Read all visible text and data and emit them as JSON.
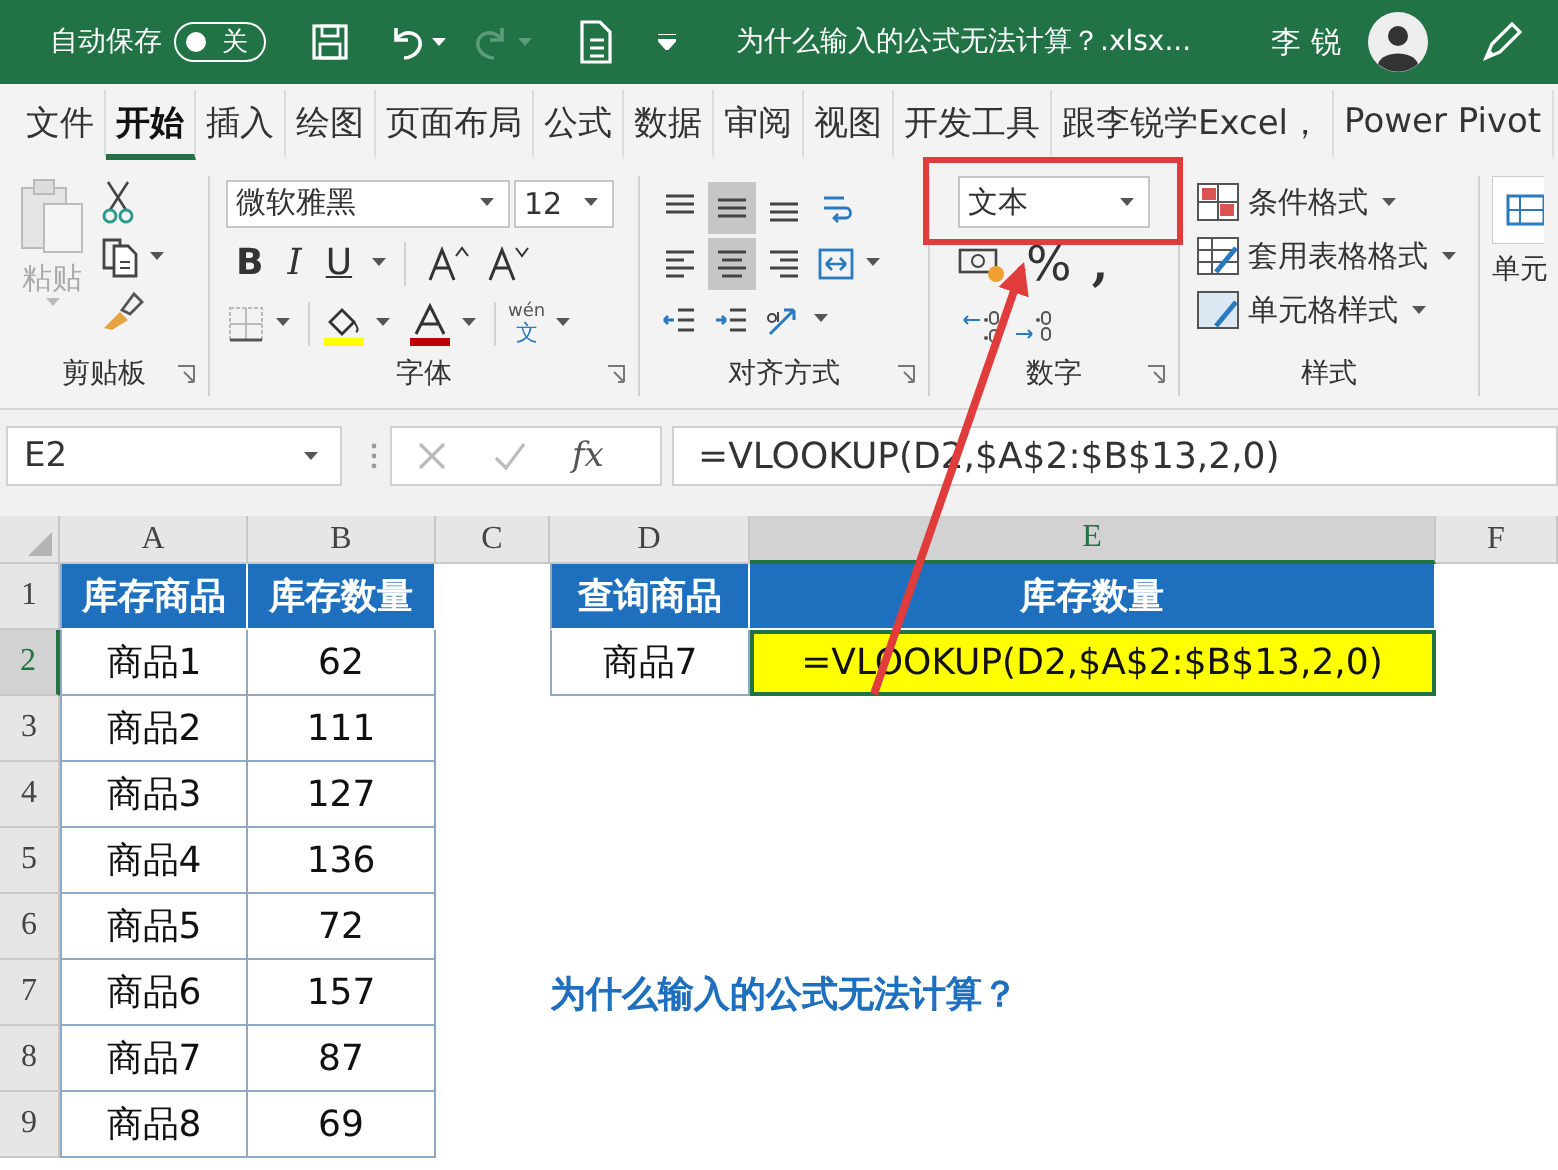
{
  "title_bar": {
    "autosave_label": "自动保存",
    "autosave": {
      "label": "关",
      "on": false
    },
    "file_name": "为什么输入的公式无法计算？.xlsx...",
    "user_name": "李 锐"
  },
  "menu_tabs": [
    {
      "label": "文件",
      "selected": false
    },
    {
      "label": "开始",
      "selected": true
    },
    {
      "label": "插入",
      "selected": false
    },
    {
      "label": "绘图",
      "selected": false
    },
    {
      "label": "页面布局",
      "selected": false
    },
    {
      "label": "公式",
      "selected": false
    },
    {
      "label": "数据",
      "selected": false
    },
    {
      "label": "审阅",
      "selected": false
    },
    {
      "label": "视图",
      "selected": false
    },
    {
      "label": "开发工具",
      "selected": false
    },
    {
      "label": "跟李锐学Excel，",
      "selected": false
    },
    {
      "label": "Power Pivot",
      "selected": false
    }
  ],
  "ribbon": {
    "clipboard": {
      "paste_label": "粘贴",
      "group_label": "剪贴板"
    },
    "font": {
      "font_name": "微软雅黑",
      "font_size": "12",
      "style_buttons": [
        "B",
        "I",
        "U"
      ],
      "phonetic_top": "wén",
      "phonetic_bottom": "文",
      "group_label": "字体"
    },
    "alignment": {
      "buttons": [
        {
          "kind": "top",
          "selected": false
        },
        {
          "kind": "middle",
          "selected": true
        },
        {
          "kind": "bottom",
          "selected": false
        },
        {
          "kind": "wrap",
          "selected": false
        },
        {
          "kind": "left",
          "selected": false
        },
        {
          "kind": "center",
          "selected": true
        },
        {
          "kind": "right",
          "selected": false
        },
        {
          "kind": "merge",
          "selected": false
        },
        {
          "kind": "outdent",
          "selected": false
        },
        {
          "kind": "indent",
          "selected": false
        },
        {
          "kind": "orientation",
          "selected": false
        }
      ],
      "group_label": "对齐方式"
    },
    "number": {
      "format": "文本",
      "percent": "%",
      "comma": ",",
      "group_label": "数字"
    },
    "styles": {
      "buttons": [
        "条件格式",
        "套用表格格式",
        "单元格样式"
      ],
      "group_label": "样式"
    },
    "cells": {
      "label": "单元"
    }
  },
  "formula_bar": {
    "name_box": "E2",
    "function_label": "fx",
    "formula": "=VLOOKUP(D2,$A$2:$B$13,2,0)"
  },
  "sheet": {
    "columns": [
      {
        "label": "A",
        "selected": false
      },
      {
        "label": "B",
        "selected": false
      },
      {
        "label": "C",
        "selected": false
      },
      {
        "label": "D",
        "selected": false
      },
      {
        "label": "E",
        "selected": true
      },
      {
        "label": "F",
        "selected": false
      }
    ],
    "rows": [
      {
        "label": "1",
        "selected": false
      },
      {
        "label": "2",
        "selected": true
      },
      {
        "label": "3",
        "selected": false
      },
      {
        "label": "4",
        "selected": false
      },
      {
        "label": "5",
        "selected": false
      },
      {
        "label": "6",
        "selected": false
      },
      {
        "label": "7",
        "selected": false
      },
      {
        "label": "8",
        "selected": false
      },
      {
        "label": "9",
        "selected": false
      }
    ],
    "stock_table": {
      "headers": [
        "库存商品",
        "库存数量"
      ],
      "rows": [
        [
          "商品1",
          "62"
        ],
        [
          "商品2",
          "111"
        ],
        [
          "商品3",
          "127"
        ],
        [
          "商品4",
          "136"
        ],
        [
          "商品5",
          "72"
        ],
        [
          "商品6",
          "157"
        ],
        [
          "商品7",
          "87"
        ],
        [
          "商品8",
          "69"
        ]
      ]
    },
    "lookup_table": {
      "headers": [
        "查询商品",
        "库存数量"
      ],
      "cells": [
        {
          "text": "商品7",
          "highlighted": false,
          "selected": false
        },
        {
          "text": "=VLOOKUP(D2,$A$2:$B$13,2,0)",
          "highlighted": true,
          "selected": true
        }
      ]
    },
    "heading": "为什么输入的公式无法计算？"
  },
  "annotations": {
    "frame": true,
    "arrow": true
  }
}
